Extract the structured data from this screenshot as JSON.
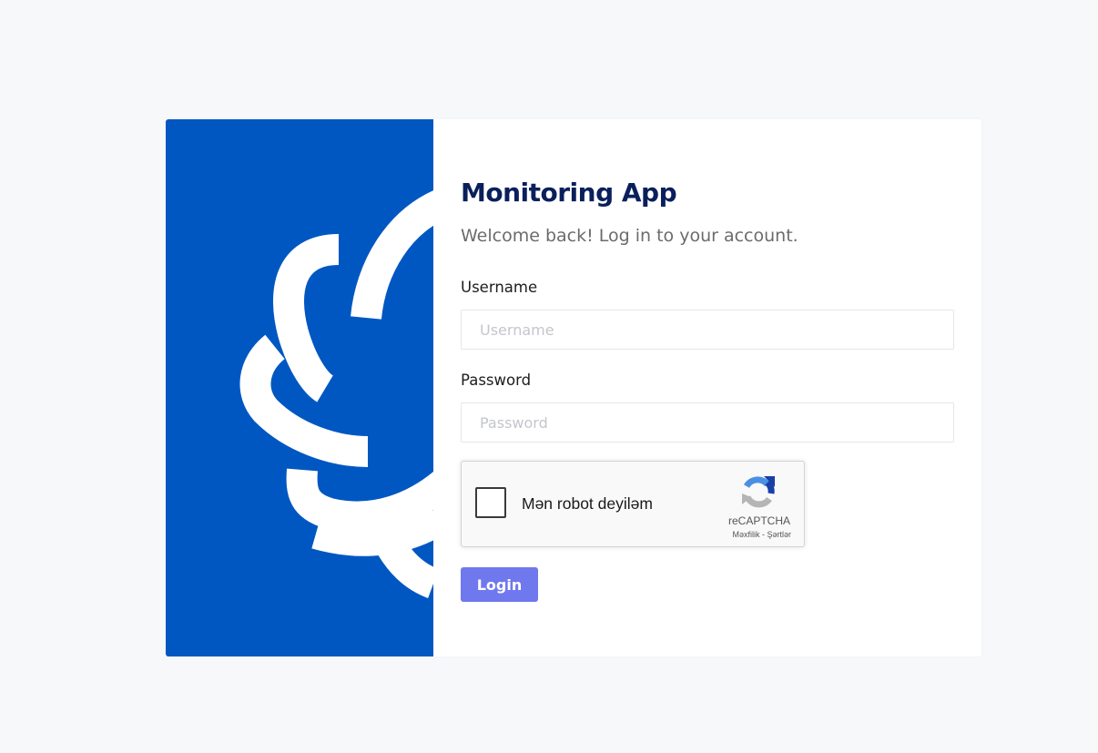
{
  "app": {
    "title": "Monitoring App",
    "subtitle": "Welcome back! Log in to your account."
  },
  "form": {
    "username_label": "Username",
    "username_placeholder": "Username",
    "username_value": "",
    "password_label": "Password",
    "password_placeholder": "Password",
    "password_value": ""
  },
  "recaptcha": {
    "checkbox_label": "Mən robot deyiləm",
    "brand": "reCAPTCHA",
    "privacy_link": "Məxfilik",
    "separator": " - ",
    "terms_link": "Şərtlər",
    "checked": false
  },
  "actions": {
    "login_label": "Login"
  },
  "colors": {
    "brand_panel": "#0057c2",
    "title": "#0a1f5c",
    "login_button": "#7078ee",
    "page_background": "#f7f8fa"
  },
  "icons": {
    "brand": "swirl-logo-icon",
    "recaptcha": "recaptcha-logo-icon"
  }
}
